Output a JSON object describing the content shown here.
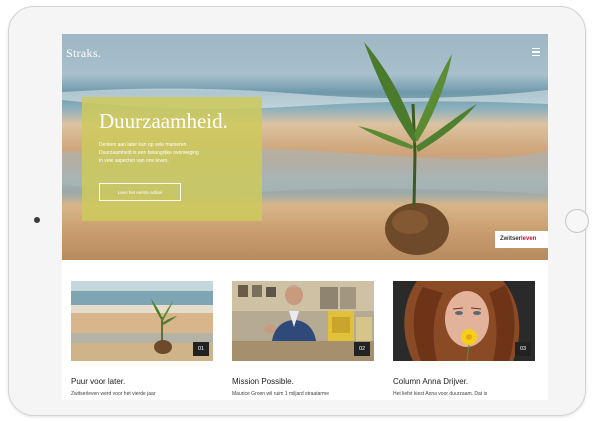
{
  "site": {
    "logo": "Straks.",
    "menu_icon": "hamburger-menu-icon"
  },
  "hero": {
    "title": "Duurzaamheid.",
    "body_lines": [
      "Denken aan later kan op vele manieren.",
      "Duurzaamheid is een belangrijke overweging",
      "in vele aspecten van ons leven."
    ],
    "button_label": "Lees het eerste artikel"
  },
  "brand_badge": {
    "part1": "Zwitser",
    "part2": "leven",
    "accent_color": "#c8102e"
  },
  "cards": [
    {
      "number": "01",
      "title": "Puur voor later.",
      "text": "Zwitserleven werd voor het vierde jaar"
    },
    {
      "number": "02",
      "title": "Mission Possible.",
      "text": "Maurice Groen wil ruim 1 miljard straatarme"
    },
    {
      "number": "03",
      "title": "Column Anna Drijver.",
      "text": "Het liefst kiest Anna voor duurzaam. Dat is"
    }
  ],
  "colors": {
    "hero_panel": "#cdca5c",
    "tablet_frame": "#f5f5f6"
  }
}
